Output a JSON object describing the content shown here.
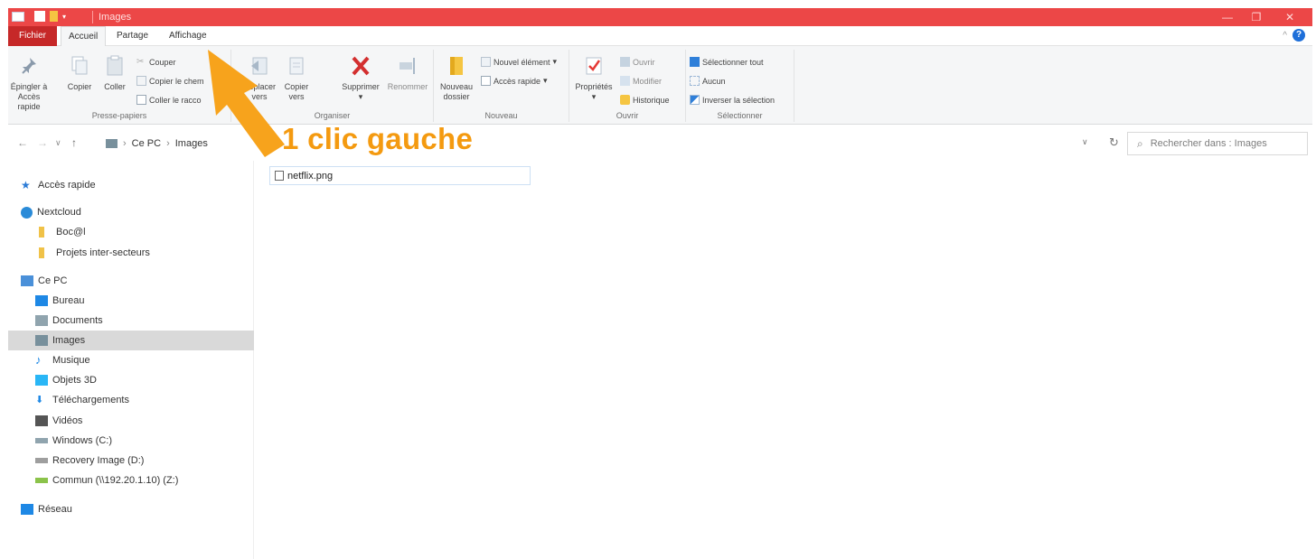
{
  "window": {
    "title": "Images",
    "minimize": "—",
    "maximize": "❐",
    "close": "✕"
  },
  "ribbon_tabs": [
    "Fichier",
    "Accueil",
    "Partage",
    "Affichage"
  ],
  "ribbon": {
    "presse_papiers": {
      "label": "Presse-papiers",
      "pin_line1": "Épingler à",
      "pin_line2": "Accès rapide",
      "copier": "Copier",
      "coller": "Coller",
      "couper": "Couper",
      "copier_chemin": "Copier le chem",
      "coller_raccourci": "Coller le racco"
    },
    "organiser": {
      "label": "Organiser",
      "deplacer_line1": "Déplacer",
      "deplacer_line2": "vers",
      "copier_line1": "Copier",
      "copier_line2": "vers",
      "supprimer": "Supprimer",
      "renommer": "Renommer"
    },
    "nouveau": {
      "label": "Nouveau",
      "nouveau_dossier_line1": "Nouveau",
      "nouveau_dossier_line2": "dossier",
      "nouvel_element": "Nouvel élément",
      "acces_rapide": "Accès rapide"
    },
    "ouvrir": {
      "label": "Ouvrir",
      "proprietes": "Propriétés",
      "ouvrir": "Ouvrir",
      "modifier": "Modifier",
      "historique": "Historique"
    },
    "selectionner": {
      "label": "Sélectionner",
      "tout": "Sélectionner tout",
      "aucun": "Aucun",
      "inverser": "Inverser la sélection"
    }
  },
  "address": {
    "crumbs": [
      "Ce PC",
      "Images"
    ],
    "search_placeholder": "Rechercher dans : Images"
  },
  "nav": [
    {
      "label": "Accès rapide",
      "icon": "star-icon",
      "color": "#2b7bd6"
    },
    {
      "label": "Nextcloud",
      "icon": "nextcloud-icon",
      "color": "#2a8bd8"
    },
    {
      "label": "Boc@l",
      "icon": "folder-icon",
      "color": "#f0c248"
    },
    {
      "label": "Projets inter-secteurs",
      "icon": "folder-icon",
      "color": "#f0c248"
    },
    {
      "label": "Ce PC",
      "icon": "computer-icon",
      "color": "#4a90d9"
    },
    {
      "label": "Bureau",
      "icon": "desktop-icon",
      "color": "#1e88e5"
    },
    {
      "label": "Documents",
      "icon": "documents-icon",
      "color": "#90a4ae"
    },
    {
      "label": "Images",
      "icon": "pictures-icon",
      "color": "#78909c"
    },
    {
      "label": "Musique",
      "icon": "music-icon",
      "color": "#1e88e5"
    },
    {
      "label": "Objets 3D",
      "icon": "objects-3d-icon",
      "color": "#29b6f6"
    },
    {
      "label": "Téléchargements",
      "icon": "download-icon",
      "color": "#1e88e5"
    },
    {
      "label": "Vidéos",
      "icon": "video-icon",
      "color": "#555555"
    },
    {
      "label": "Windows (C:)",
      "icon": "drive-icon",
      "color": "#90a4ae"
    },
    {
      "label": "Recovery Image (D:)",
      "icon": "drive-icon",
      "color": "#9e9e9e"
    },
    {
      "label": "Commun (\\\\192.20.1.10) (Z:)",
      "icon": "network-drive-icon",
      "color": "#8bc34a"
    },
    {
      "label": "Réseau",
      "icon": "network-icon",
      "color": "#1e88e5"
    }
  ],
  "selected_nav": "Images",
  "files": [
    {
      "name": "netflix.png",
      "icon": "png-file-icon"
    }
  ],
  "annotation": {
    "text": "1 clic gauche",
    "color": "#f49a10"
  }
}
